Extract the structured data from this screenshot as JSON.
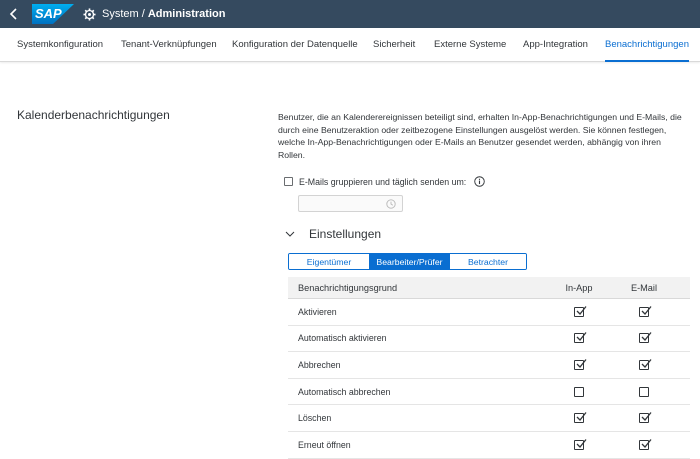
{
  "shell": {
    "logo_text": "SAP",
    "title_prefix": "System / ",
    "title_main": "Administration",
    "colors": {
      "shellbar": "#354a5f",
      "accent": "#0a6ed1"
    }
  },
  "tabs": [
    {
      "label": "Systemkonfiguration",
      "active": false
    },
    {
      "label": "Tenant-Verknüpfungen",
      "active": false
    },
    {
      "label": "Konfiguration der Datenquelle",
      "active": false
    },
    {
      "label": "Sicherheit",
      "active": false
    },
    {
      "label": "Externe Systeme",
      "active": false
    },
    {
      "label": "App-Integration",
      "active": false
    },
    {
      "label": "Benachrichtigungen",
      "active": true
    }
  ],
  "section": {
    "title": "Kalenderbenachrichtigungen",
    "description": "Benutzer, die an Kalenderereignissen beteiligt sind, erhalten In-App-Benachrichtigungen und E-Mails, die durch eine Benutzeraktion oder zeitbezogene Einstellungen ausgelöst werden. Sie können festlegen, welche In-App-Benachrichtigungen oder E-Mails an Benutzer gesendet werden, abhängig von ihren Rollen."
  },
  "email_group": {
    "label": "E-Mails gruppieren und täglich senden um:",
    "checked": false,
    "time_value": ""
  },
  "settings": {
    "title": "Einstellungen",
    "roles": [
      {
        "label": "Eigentümer",
        "selected": false
      },
      {
        "label": "Bearbeiter/Prüfer",
        "selected": true
      },
      {
        "label": "Betrachter",
        "selected": false
      }
    ]
  },
  "table": {
    "headers": {
      "reason": "Benachrichtigungsgrund",
      "inapp": "In-App",
      "email": "E-Mail"
    },
    "rows": [
      {
        "reason": "Aktivieren",
        "inapp": true,
        "email": true
      },
      {
        "reason": "Automatisch aktivieren",
        "inapp": true,
        "email": true
      },
      {
        "reason": "Abbrechen",
        "inapp": true,
        "email": true
      },
      {
        "reason": "Automatisch abbrechen",
        "inapp": false,
        "email": false
      },
      {
        "reason": "Löschen",
        "inapp": true,
        "email": true
      },
      {
        "reason": "Erneut öffnen",
        "inapp": true,
        "email": true
      }
    ]
  }
}
